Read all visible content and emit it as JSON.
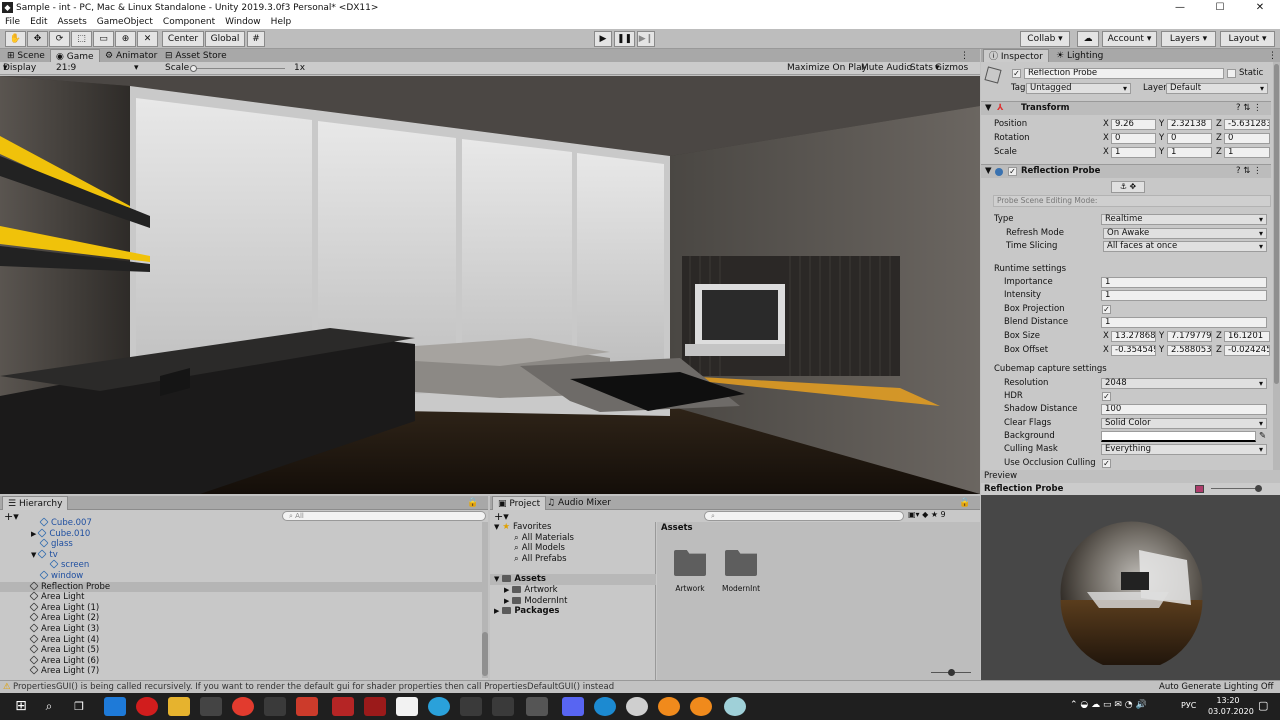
{
  "window": {
    "title": "Sample - int - PC, Mac & Linux Standalone - Unity 2019.3.0f3 Personal* <DX11>",
    "minimize": "—",
    "maximize": "☐",
    "close": "✕"
  },
  "menu": [
    "File",
    "Edit",
    "Assets",
    "GameObject",
    "Component",
    "Window",
    "Help"
  ],
  "toolbar": {
    "center": "Center",
    "global": "Global",
    "collab": "Collab ▾",
    "account": "Account",
    "layers": "Layers",
    "layout": "Layout"
  },
  "scene_tabs": {
    "scene": "Scene",
    "game": "Game",
    "animator": "Animator",
    "asset_store": "Asset Store"
  },
  "game_bar": {
    "display": "Display 1",
    "aspect": "21:9",
    "scale_label": "Scale",
    "scale_value": "1x",
    "maximize": "Maximize On Play",
    "mute": "Mute Audio",
    "stats": "Stats",
    "gizmos": "Gizmos"
  },
  "inspector": {
    "tab": "Inspector",
    "tab2": "Lighting",
    "object_name": "Reflection Probe",
    "static": "Static",
    "tag_label": "Tag",
    "tag_value": "Untagged",
    "layer_label": "Layer",
    "layer_value": "Default",
    "transform": {
      "title": "Transform",
      "position": {
        "label": "Position",
        "x": "9.26",
        "y": "2.32138",
        "z": "-5.631283"
      },
      "rotation": {
        "label": "Rotation",
        "x": "0",
        "y": "0",
        "z": "0"
      },
      "scale": {
        "label": "Scale",
        "x": "1",
        "y": "1",
        "z": "1"
      }
    },
    "probe": {
      "title": "Reflection Probe",
      "editing_mode": "Probe Scene Editing Mode:",
      "type_label": "Type",
      "type_value": "Realtime",
      "refresh_label": "Refresh Mode",
      "refresh_value": "On Awake",
      "slicing_label": "Time Slicing",
      "slicing_value": "All faces at once",
      "runtime": "Runtime settings",
      "importance_label": "Importance",
      "importance_value": "1",
      "intensity_label": "Intensity",
      "intensity_value": "1",
      "box_proj_label": "Box Projection",
      "blend_label": "Blend Distance",
      "blend_value": "1",
      "box_size": {
        "label": "Box Size",
        "x": "13.27868",
        "y": "7.179779",
        "z": "16.1201"
      },
      "box_offset": {
        "label": "Box Offset",
        "x": "-0.354549",
        "y": "2.588053",
        "z": "-0.024245"
      },
      "cubemap": "Cubemap capture settings",
      "resolution_label": "Resolution",
      "resolution_value": "2048",
      "hdr_label": "HDR",
      "shadow_label": "Shadow Distance",
      "shadow_value": "100",
      "clear_label": "Clear Flags",
      "clear_value": "Solid Color",
      "background_label": "Background",
      "culling_label": "Culling Mask",
      "culling_value": "Everything",
      "occlusion_label": "Use Occlusion Culling"
    },
    "axis": {
      "x": "X",
      "y": "Y",
      "z": "Z"
    },
    "check": "✓"
  },
  "preview": {
    "tab": "Preview",
    "title": "Reflection Probe"
  },
  "hierarchy": {
    "tab": "Hierarchy",
    "search_placeholder": "All",
    "items": [
      {
        "label": "Cube.007",
        "indent": 2,
        "prefab": true
      },
      {
        "label": "Cube.010",
        "indent": 2,
        "prefab": true,
        "arrow": "▶"
      },
      {
        "label": "glass",
        "indent": 2,
        "prefab": true
      },
      {
        "label": "tv",
        "indent": 2,
        "prefab": true,
        "arrow": "▼"
      },
      {
        "label": "screen",
        "indent": 3,
        "prefab": true
      },
      {
        "label": "window",
        "indent": 2,
        "prefab": true
      },
      {
        "label": "Reflection Probe",
        "indent": 1,
        "selected": true
      },
      {
        "label": "Area Light",
        "indent": 1
      },
      {
        "label": "Area Light (1)",
        "indent": 1
      },
      {
        "label": "Area Light (2)",
        "indent": 1
      },
      {
        "label": "Area Light (3)",
        "indent": 1
      },
      {
        "label": "Area Light (4)",
        "indent": 1
      },
      {
        "label": "Area Light (5)",
        "indent": 1
      },
      {
        "label": "Area Light (6)",
        "indent": 1
      },
      {
        "label": "Area Light (7)",
        "indent": 1
      }
    ]
  },
  "project": {
    "tab": "Project",
    "tab2": "Audio Mixer",
    "count": "9",
    "tree": [
      {
        "label": "Favorites",
        "indent": 0,
        "arrow": "▼",
        "star": true
      },
      {
        "label": "All Materials",
        "indent": 1
      },
      {
        "label": "All Models",
        "indent": 1
      },
      {
        "label": "All Prefabs",
        "indent": 1
      },
      {
        "label": "Assets",
        "indent": 0,
        "arrow": "▼",
        "folder": true,
        "bold": true
      },
      {
        "label": "Artwork",
        "indent": 1,
        "arrow": "▶",
        "folder": true
      },
      {
        "label": "ModernInt",
        "indent": 1,
        "arrow": "▶",
        "folder": true
      },
      {
        "label": "Packages",
        "indent": 0,
        "arrow": "▶",
        "folder": true,
        "bold": true
      }
    ],
    "assets_header": "Assets",
    "assets": [
      "Artwork",
      "ModernInt"
    ]
  },
  "status": {
    "message": "PropertiesGUI() is being called recursively. If you want to render the default gui for shader properties then call PropertiesDefaultGUI() instead",
    "right": "Auto Generate Lighting Off"
  },
  "taskbar": {
    "time": "13:20",
    "date": "03.07.2020",
    "lang": "РУС"
  },
  "colors": {
    "accent": "#3a72b0",
    "yellow_light": "#f0c20a",
    "orange_glow": "#e8a020"
  }
}
